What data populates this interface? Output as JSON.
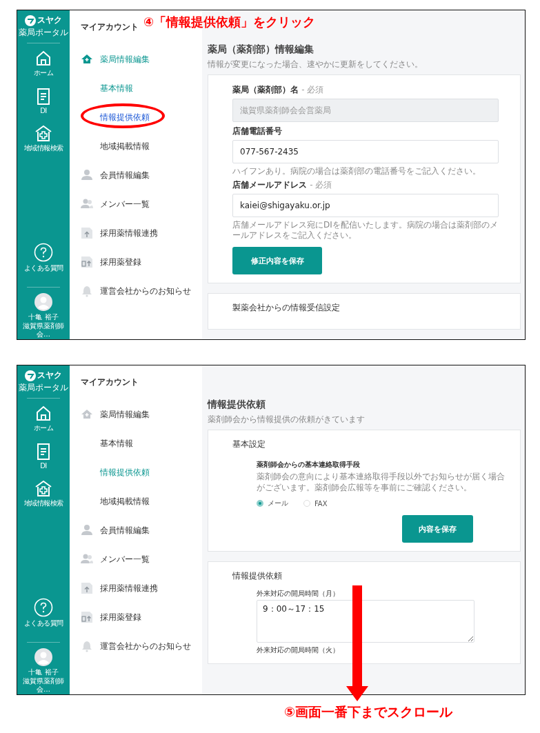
{
  "screens": [
    {
      "annotation": "④「情報提供依頼」をクリック",
      "rail": {
        "logo": "スヤク",
        "logo_sub": "薬局ポータル",
        "items": [
          {
            "label": "ホーム"
          },
          {
            "label": "DI"
          },
          {
            "label": "地域情報検索"
          }
        ],
        "help": "よくある質問",
        "user_name": "十亀 裕子",
        "user_org": "滋賀県薬剤師会…"
      },
      "nav": {
        "heading": "マイアカウント",
        "items": [
          {
            "kind": "section",
            "label": "薬局情報編集",
            "selected": true,
            "hover": false,
            "circled": false
          },
          {
            "kind": "sub",
            "label": "基本情報",
            "selected": true,
            "hover": false,
            "circled": false
          },
          {
            "kind": "sub",
            "label": "情報提供依頼",
            "selected": false,
            "hover": true,
            "circled": true
          },
          {
            "kind": "sub",
            "label": "地域掲載情報",
            "selected": false,
            "hover": false,
            "circled": false
          },
          {
            "kind": "section",
            "label": "会員情報編集",
            "selected": false,
            "hover": false,
            "circled": false
          },
          {
            "kind": "section",
            "label": "メンバー一覧",
            "selected": false,
            "hover": false,
            "circled": false
          },
          {
            "kind": "section",
            "label": "採用薬情報連携",
            "selected": false,
            "hover": false,
            "circled": false
          },
          {
            "kind": "section",
            "label": "採用薬登録",
            "selected": false,
            "hover": false,
            "circled": false
          },
          {
            "kind": "section",
            "label": "運営会社からのお知らせ",
            "selected": false,
            "hover": false,
            "circled": false
          }
        ]
      },
      "main": {
        "title": "薬局（薬剤部）情報編集",
        "subtitle": "情報が変更になった場合、速やかに更新をしてください。",
        "cards": [
          {
            "blocks": [
              {
                "kind": "field",
                "label": "薬局（薬剤部）名",
                "required": "- 必須",
                "value": "滋賀県薬剤師会会営薬局",
                "disabled": true
              },
              {
                "kind": "field",
                "label": "店舗電話番号",
                "value": "077-567-2435",
                "disabled": false,
                "help": "ハイフンあり。病院の場合は薬剤部の電話番号をご記入ください。"
              },
              {
                "kind": "field",
                "label": "店舗メールアドレス",
                "required": "- 必須",
                "value": "kaiei@shigayaku.or.jp",
                "disabled": false,
                "help": "店舗メールアドレス宛にDIを配信いたします。病院の場合は薬剤部のメールアドレスをご記入ください。"
              },
              {
                "kind": "button",
                "label": "修正内容を保存"
              }
            ]
          },
          {
            "title": "製薬会社からの情報受信設定"
          }
        ]
      }
    },
    {
      "caption": "⑤画面一番下までスクロール",
      "scroll_arrow": true,
      "rail": {
        "logo": "スヤク",
        "logo_sub": "薬局ポータル",
        "items": [
          {
            "label": "ホーム"
          },
          {
            "label": "DI"
          },
          {
            "label": "地域情報検索"
          }
        ],
        "help": "よくある質問",
        "user_name": "十亀 裕子",
        "user_org": "滋賀県薬剤師会…"
      },
      "nav": {
        "heading": "マイアカウント",
        "items": [
          {
            "kind": "section",
            "label": "薬局情報編集",
            "selected": false,
            "hover": false,
            "circled": false
          },
          {
            "kind": "sub",
            "label": "基本情報",
            "selected": false,
            "hover": false,
            "circled": false
          },
          {
            "kind": "sub",
            "label": "情報提供依頼",
            "selected": true,
            "hover": false,
            "circled": false
          },
          {
            "kind": "sub",
            "label": "地域掲載情報",
            "selected": false,
            "hover": false,
            "circled": false
          },
          {
            "kind": "section",
            "label": "会員情報編集",
            "selected": false,
            "hover": false,
            "circled": false
          },
          {
            "kind": "section",
            "label": "メンバー一覧",
            "selected": false,
            "hover": false,
            "circled": false
          },
          {
            "kind": "section",
            "label": "採用薬情報連携",
            "selected": false,
            "hover": false,
            "circled": false
          },
          {
            "kind": "section",
            "label": "採用薬登録",
            "selected": false,
            "hover": false,
            "circled": false
          },
          {
            "kind": "section",
            "label": "運営会社からのお知らせ",
            "selected": false,
            "hover": false,
            "circled": false
          }
        ]
      },
      "main": {
        "title": "情報提供依頼",
        "subtitle": "薬剤師会から情報提供の依頼がきています",
        "cards": [
          {
            "title": "基本設定",
            "blocks": [
              {
                "kind": "radios",
                "label": "薬剤師会からの基本連絡取得手段",
                "description": "薬剤師会の意向により基本連絡取得手段以外でお知らせが届く場合がございます。薬剤師会広報等を事前にご確認ください。",
                "options": [
                  {
                    "label": "メール",
                    "selected": true
                  },
                  {
                    "label": "FAX",
                    "selected": false
                  }
                ]
              },
              {
                "kind": "button",
                "label": "内容を保存"
              }
            ]
          },
          {
            "title": "情報提供依頼",
            "blocks": [
              {
                "kind": "textarea",
                "label": "外来対応の開局時間（月）",
                "value": "9：00～17：15"
              },
              {
                "kind": "label",
                "label": "外来対応の開局時間（火）"
              }
            ]
          }
        ]
      }
    }
  ]
}
